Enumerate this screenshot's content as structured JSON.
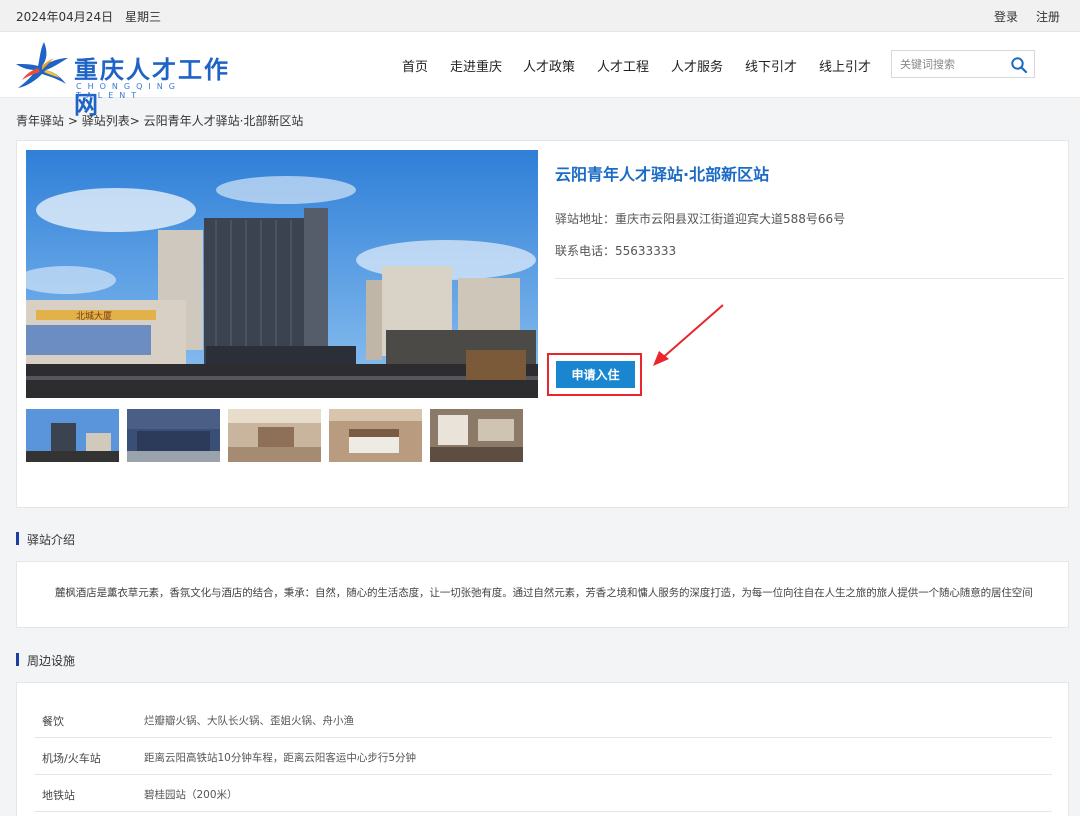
{
  "topbar": {
    "date": "2024年04月24日",
    "weekday": "星期三",
    "login": "登录",
    "register": "注册"
  },
  "logo": {
    "title": "重庆人才工作网",
    "subtitle": "CHONGQING TALENT"
  },
  "nav": {
    "items": [
      "首页",
      "走进重庆",
      "人才政策",
      "人才工程",
      "人才服务",
      "线下引才",
      "线上引才"
    ]
  },
  "search": {
    "placeholder": "关键词搜索",
    "icon": "search-icon"
  },
  "breadcrumb": {
    "level1": "青年驿站",
    "sep1": " > ",
    "level2": "驿站列表",
    "sep2": "> ",
    "level3": "云阳青年人才驿站·北部新区站"
  },
  "station": {
    "title": "云阳青年人才驿站·北部新区站",
    "address_label": "驿站地址：",
    "address": "重庆市云阳县双江街道迎宾大道588号66号",
    "phone_label": "联系电话：",
    "phone": "55633333",
    "apply_label": "申请入住",
    "hotel_sign": "北城大厦"
  },
  "intro": {
    "heading": "驿站介绍",
    "text": "麓枫酒店是薰衣草元素，香氛文化与酒店的结合，秉承：自然，随心的生活态度，让一切张弛有度。通过自然元素，芳香之境和慵人服务的深度打造，为每一位向往自在人生之旅的旅人提供一个随心随意的居住空间"
  },
  "facilities": {
    "heading": "周边设施",
    "rows": [
      {
        "key": "餐饮",
        "value": "烂瓣瓣火锅、大队长火锅、歪姐火锅、舟小渔"
      },
      {
        "key": "机场/火车站",
        "value": "距离云阳高铁站10分钟车程，距离云阳客运中心步行5分钟"
      },
      {
        "key": "地铁站",
        "value": "碧桂园站（200米）"
      }
    ]
  },
  "colors": {
    "accent": "#1a86d0",
    "title_blue": "#1a6bc6",
    "highlight_red": "#e8262c"
  }
}
